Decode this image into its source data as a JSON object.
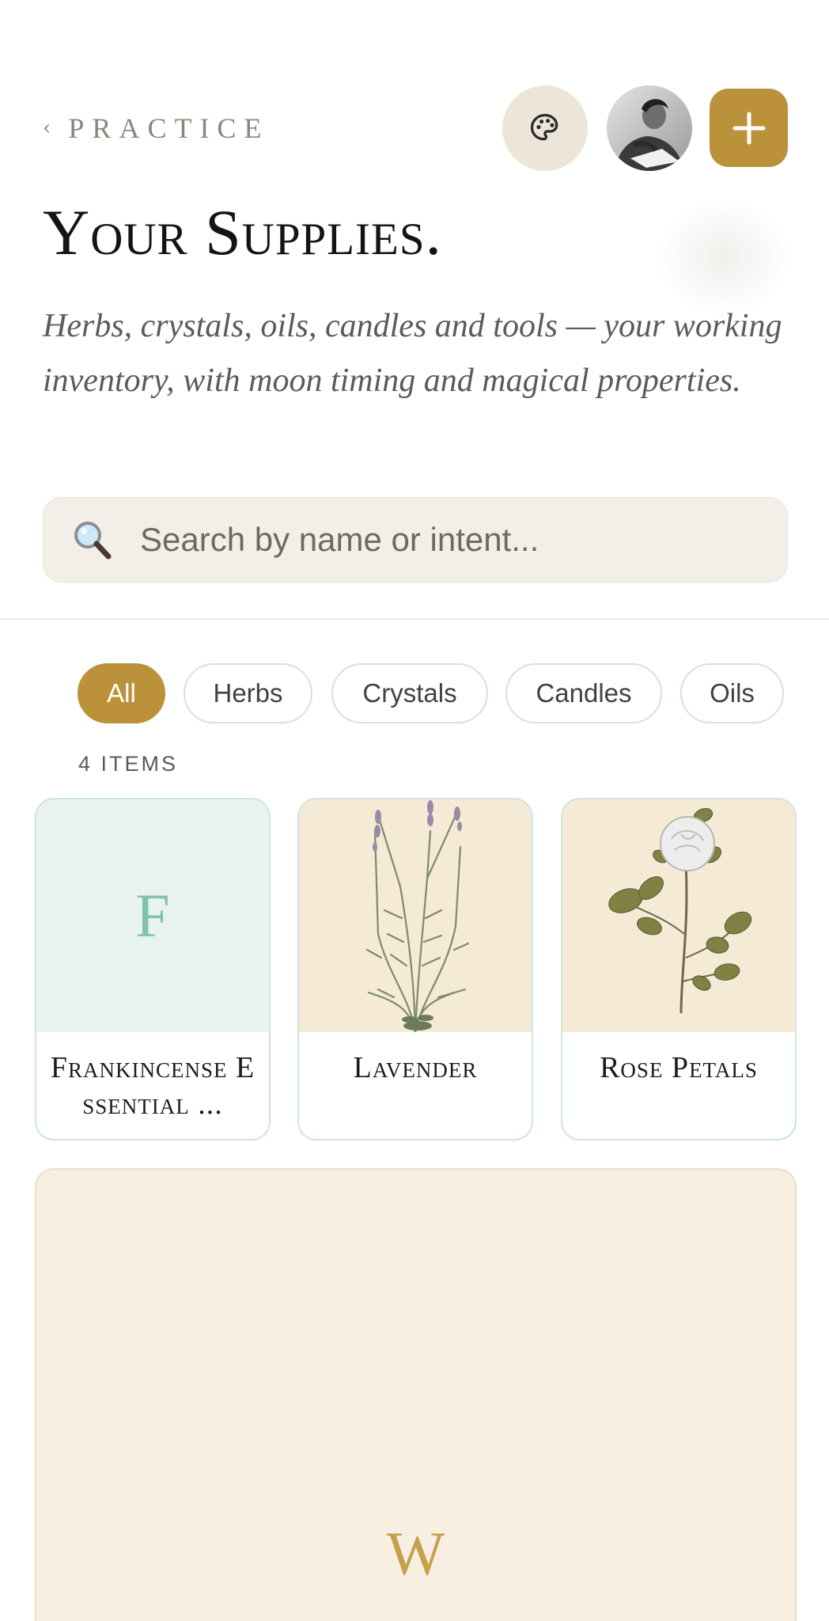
{
  "header": {
    "back_chevron": "‹",
    "back_label": "PRACTICE",
    "palette_icon": "palette-icon",
    "avatar_icon": "user-photo",
    "add_icon": "plus-icon"
  },
  "page": {
    "title": "Your Supplies.",
    "subtitle": "Herbs, crystals, oils, candles and tools — your working inventory, with moon timing and magical properties."
  },
  "search": {
    "placeholder": "Search by name or intent...",
    "value": "",
    "icon": "search-icon"
  },
  "filters": {
    "chips": [
      "All",
      "Herbs",
      "Crystals",
      "Candles",
      "Oils"
    ],
    "active": "All"
  },
  "inventory": {
    "count_label": "4 ITEMS",
    "items": [
      {
        "name": "Frankincense Essential ...",
        "thumb": "letter",
        "letter": "F"
      },
      {
        "name": "Lavender",
        "thumb": "botanical-illustration"
      },
      {
        "name": "Rose Petals",
        "thumb": "botanical-illustration"
      },
      {
        "name": "",
        "thumb": "letter",
        "letter": "W"
      }
    ]
  },
  "colors": {
    "accent": "#bb923a",
    "card_border": "#cfe5df",
    "letter_tile_bg": "#e8f3ef",
    "letter_tile_text": "#7ec3aa",
    "wide_card_bg": "#f6efe2"
  }
}
